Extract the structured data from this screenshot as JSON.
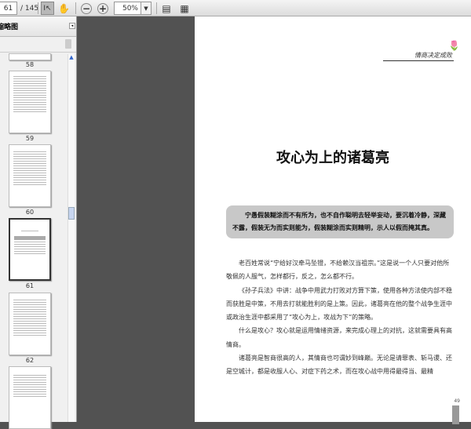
{
  "toolbar": {
    "page_current": "61",
    "page_total": "/ 145",
    "zoom": "50%"
  },
  "sidebar": {
    "title": "缩略图",
    "thumbnails": [
      {
        "label": "58"
      },
      {
        "label": "59"
      },
      {
        "label": "60"
      },
      {
        "label": "61"
      },
      {
        "label": "62"
      }
    ]
  },
  "page": {
    "header": "情商决定成败",
    "title": "攻心为上的诸葛亮",
    "quote": "宁愚假装糊涂而不有所为，也不自作聪明去轻举妄动，要沉着冷静，深藏不露，假装无为而实则能为，假装糊涂而实则精明，示人以假而掩其真。",
    "paragraphs": [
      "老百姓常说“宁给好汉牵马坠镫，不给赖汉当祖宗。”这是说一个人只要对他所敬佩的人服气，怎样都行，反之，怎么都不行。",
      "《孙子兵法》中讲：战争中用武力打败对方算下策，使用各种方法使内部不稳而获胜是中策，不用去打就能胜利的是上策。因此，诸葛亮在他的整个战争生涯中或政治生涯中都采用了“攻心为上，攻战为下”的策略。",
      "什么是攻心？攻心就是运用情绪资源，来完成心理上的对抗，这就需要具有高情商。",
      "诸葛亮是智商很高的人，其情商也可谓妙到峰巅。无论是请罪表、斩马谡、还是空城计，都是收服人心、对症下药之术，而在攻心战中用得最得当、最精"
    ],
    "page_number": "49"
  }
}
